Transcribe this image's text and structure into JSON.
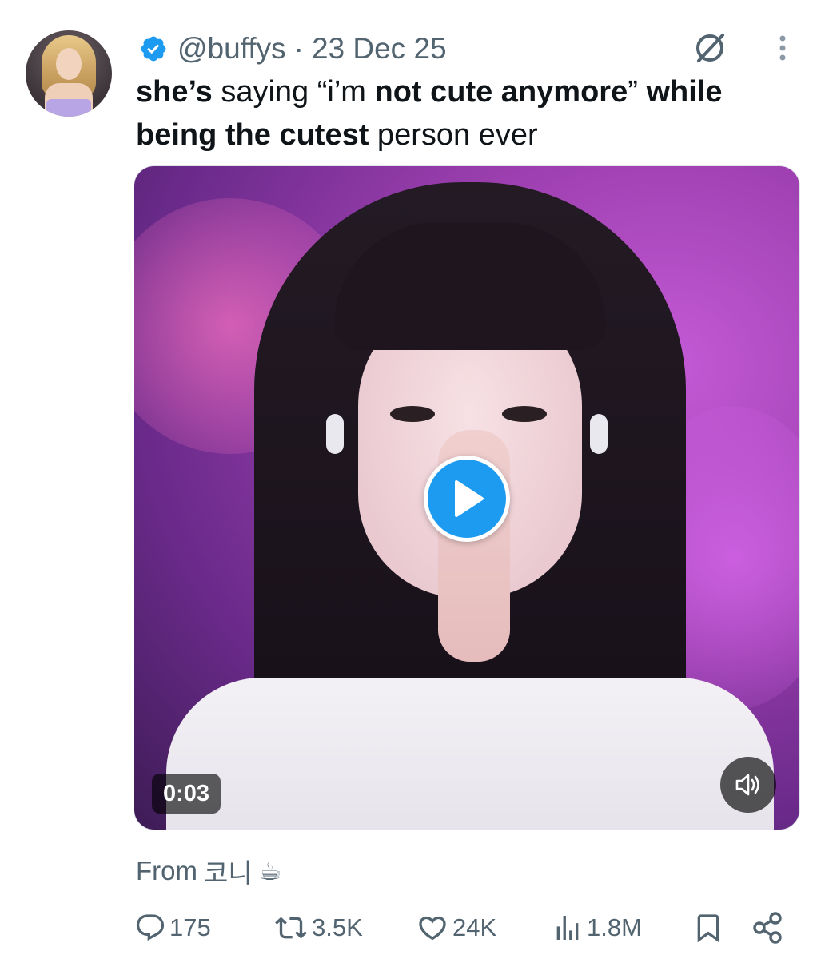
{
  "post": {
    "handle": "@buffys",
    "separator": "·",
    "date": "23 Dec 25",
    "text_parts": [
      {
        "text": "she’s",
        "bold": true
      },
      {
        "text": " saying “i’m ",
        "bold": false
      },
      {
        "text": "not cute anymore",
        "bold": true
      },
      {
        "text": "” ",
        "bold": false
      },
      {
        "text": "while being the cutest",
        "bold": true
      },
      {
        "text": " person ever",
        "bold": false
      }
    ],
    "media": {
      "duration": "0:03"
    },
    "source": {
      "label": "From",
      "name": "코니",
      "emoji": "☕"
    }
  },
  "actions": {
    "replies": "175",
    "reposts": "3.5K",
    "likes": "24K",
    "views": "1.8M"
  },
  "icons": {
    "verified": "verified-badge-icon",
    "grok": "grok-icon",
    "more": "more-vertical-icon",
    "play": "play-icon",
    "volume": "volume-icon",
    "reply": "reply-icon",
    "repost": "repost-icon",
    "like": "like-icon",
    "views": "views-icon",
    "bookmark": "bookmark-icon",
    "share": "share-icon"
  },
  "colors": {
    "accent": "#1d9bf0",
    "secondary_text": "#536471",
    "primary_text": "#0f1419"
  }
}
